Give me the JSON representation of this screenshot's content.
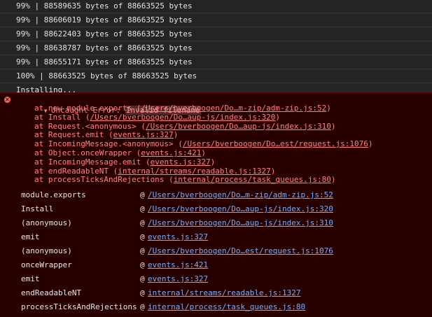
{
  "progress": [
    "99% | 88589635 bytes of 88663525 bytes",
    "99% | 88606019 bytes of 88663525 bytes",
    "99% | 88622403 bytes of 88663525 bytes",
    "99% | 88638787 bytes of 88663525 bytes",
    "99% | 88655171 bytes of 88663525 bytes",
    "100% | 88663525 bytes of 88663525 bytes",
    "Installing..."
  ],
  "error": {
    "prefix": "Uncaught Error: ",
    "message": "Invalid filename",
    "frames": [
      {
        "pre": "at new module.exports (",
        "link": "/Users/bverboogen/Do…m-zip/adm-zip.js:52",
        "post": ")"
      },
      {
        "pre": "at Install (",
        "link": "/Users/bverboogen/Do…aup-js/index.js:320",
        "post": ")"
      },
      {
        "pre": "at Request.<anonymous> (",
        "link": "/Users/bverboogen/Do…aup-js/index.js:310",
        "post": ")"
      },
      {
        "pre": "at Request.emit (",
        "link": "events.js:327",
        "post": ")"
      },
      {
        "pre": "at IncomingMessage.<anonymous> (",
        "link": "/Users/bverboogen/Do…est/request.js:1076",
        "post": ")"
      },
      {
        "pre": "at Object.onceWrapper (",
        "link": "events.js:421",
        "post": ")"
      },
      {
        "pre": "at IncomingMessage.emit (",
        "link": "events.js:327",
        "post": ")"
      },
      {
        "pre": "at endReadableNT (",
        "link": "internal/streams/readable.js:1327",
        "post": ")"
      },
      {
        "pre": "at processTicksAndRejections (",
        "link": "internal/process/task_queues.js:80",
        "post": ")"
      }
    ]
  },
  "stack_table": [
    {
      "fn": "module.exports",
      "at": "@",
      "src": "/Users/bverboogen/Do…m-zip/adm-zip.js:52"
    },
    {
      "fn": "Install",
      "at": "@",
      "src": "/Users/bverboogen/Do…aup-js/index.js:320"
    },
    {
      "fn": "(anonymous)",
      "at": "@",
      "src": "/Users/bverboogen/Do…aup-js/index.js:310"
    },
    {
      "fn": "emit",
      "at": "@",
      "src": "events.js:327"
    },
    {
      "fn": "(anonymous)",
      "at": "@",
      "src": "/Users/bverboogen/Do…est/request.js:1076"
    },
    {
      "fn": "onceWrapper",
      "at": "@",
      "src": "events.js:421"
    },
    {
      "fn": "emit",
      "at": "@",
      "src": "events.js:327"
    },
    {
      "fn": "endReadableNT",
      "at": "@",
      "src": "internal/streams/readable.js:1327"
    },
    {
      "fn": "processTicksAndRejections",
      "at": "@",
      "src": "internal/process/task_queues.js:80"
    }
  ],
  "icons": {
    "error": "error-circle-icon",
    "expand": "triangle-down-icon"
  },
  "colors": {
    "error_bg": "#290000",
    "error_text": "#ff8080",
    "link": "#7cacf8"
  }
}
